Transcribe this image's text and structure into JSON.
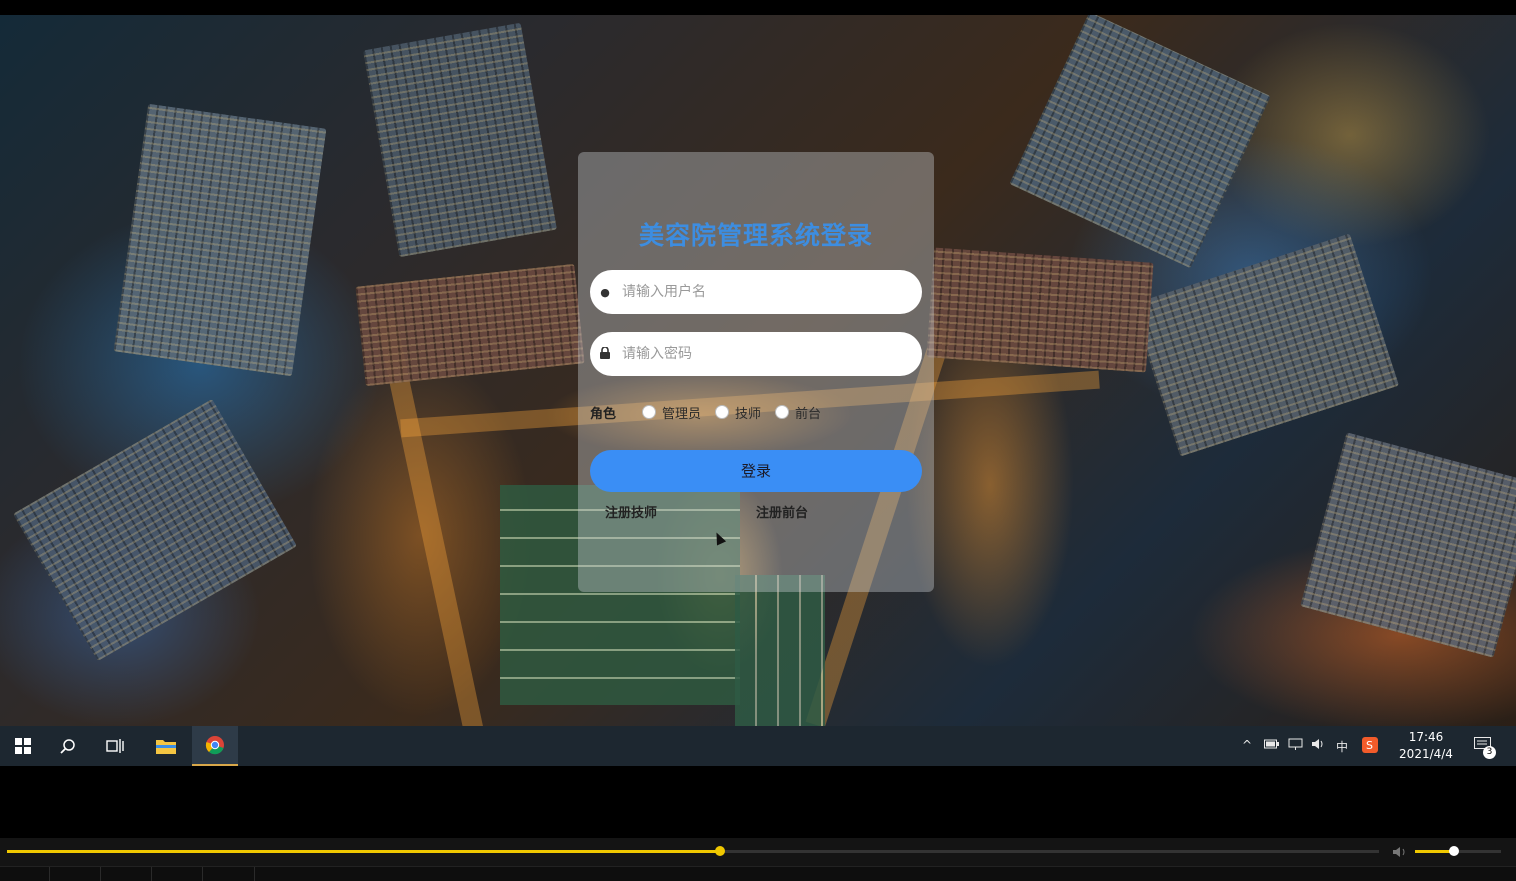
{
  "login": {
    "title": "美容院管理系统登录",
    "username_placeholder": "请输入用户名",
    "password_placeholder": "请输入密码",
    "role_label": "角色",
    "roles": [
      "管理员",
      "技师",
      "前台"
    ],
    "login_button": "登录",
    "register_technician": "注册技师",
    "register_reception": "注册前台"
  },
  "taskbar": {
    "icons": [
      "windows-start-icon",
      "search-icon",
      "task-view-icon",
      "file-explorer-icon",
      "chrome-icon"
    ],
    "tray": {
      "language": "中",
      "time": "17:46",
      "date": "2021/4/4",
      "notification_count": "3"
    }
  },
  "player": {
    "progress": 0.52,
    "volume": 0.45,
    "accent_color": "#f0c800"
  },
  "colors": {
    "title": "#3d8de0",
    "button": "#3a8ef5"
  }
}
